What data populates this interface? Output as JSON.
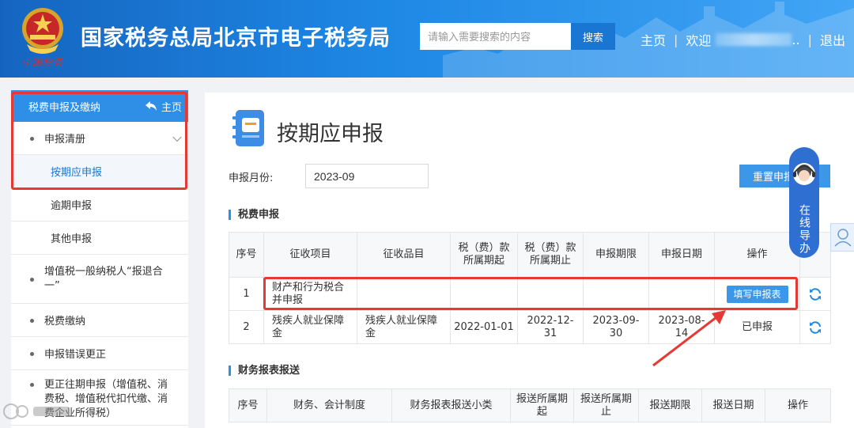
{
  "header": {
    "site_title": "国家税务总局北京市电子税务局",
    "brand_sign": "中国税务",
    "search_placeholder": "请输入需要搜索的内容",
    "search_label": "搜索",
    "nav_home": "主页",
    "nav_sep": "|",
    "nav_welcome": "欢迎",
    "nav_welcome_suffix": "..",
    "nav_logout": "退出"
  },
  "sidebar": {
    "header_label": "税费申报及缴纳",
    "home_label": "主页",
    "items": [
      {
        "label": "申报清册"
      },
      {
        "label": "按期应申报"
      },
      {
        "label": "逾期申报"
      },
      {
        "label": "其他申报"
      },
      {
        "label": "增值税一般纳税人“报退合一”"
      },
      {
        "label": "税费缴纳"
      },
      {
        "label": "申报错误更正"
      },
      {
        "label": "更正往期申报（增值税、消费税、增值税代扣代缴、消费企业所得税）"
      }
    ]
  },
  "main": {
    "page_title": "按期应申报",
    "month_label": "申报月份:",
    "month_value": "2023-09",
    "reset_label": "重置申报",
    "section1_title": "税费申报",
    "table1": {
      "headers": [
        "序号",
        "征收项目",
        "征收品目",
        "税（费）款所属期起",
        "税（费）款所属期止",
        "申报期限",
        "申报日期",
        "操作"
      ],
      "rows": [
        {
          "no": "1",
          "item": "财产和行为税合并申报",
          "subitem": "",
          "start": "",
          "end": "",
          "deadline": "",
          "date": "",
          "action": "填写申报表"
        },
        {
          "no": "2",
          "item": "残疾人就业保障金",
          "subitem": "残疾人就业保障金",
          "start": "2022-01-01",
          "end": "2022-12-31",
          "deadline": "2023-09-30",
          "date": "2023-08-14",
          "action": "已申报"
        }
      ]
    },
    "section2_title": "财务报表报送",
    "table2": {
      "headers": [
        "序号",
        "财务、会计制度",
        "财务报表报送小类",
        "报送所属期起",
        "报送所属期止",
        "报送期限",
        "报送日期",
        "操作"
      ]
    }
  },
  "float": {
    "online_guide": "在线导办"
  }
}
